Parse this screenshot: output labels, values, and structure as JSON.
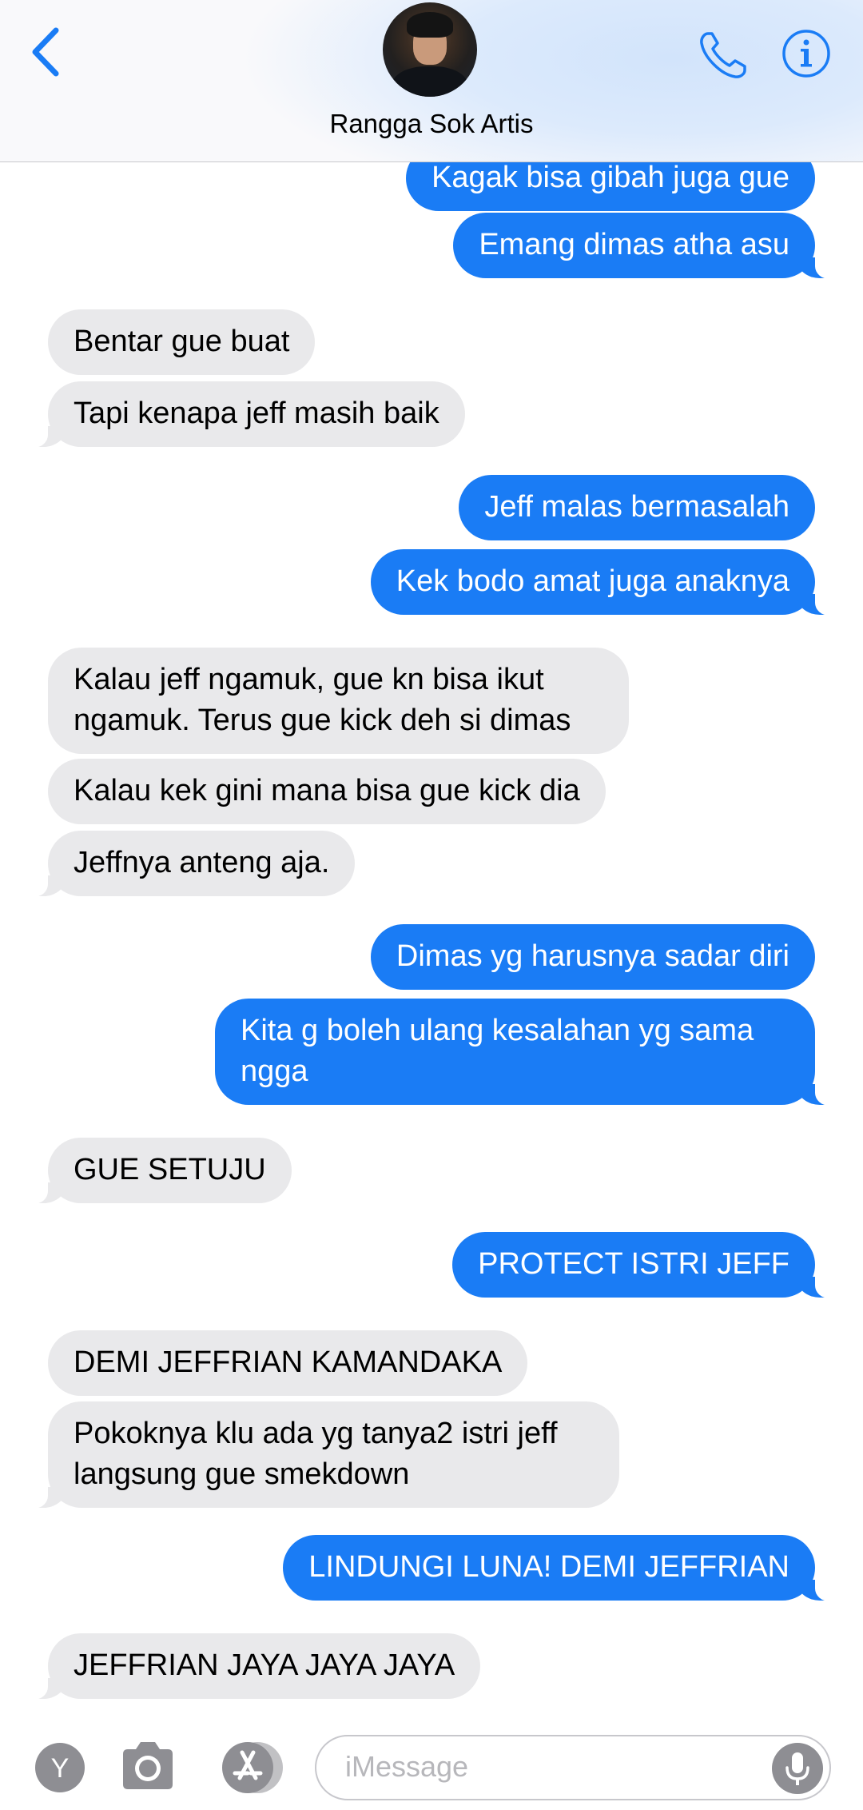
{
  "header": {
    "contact_name": "Rangga Sok Artis"
  },
  "messages": [
    {
      "side": "sent",
      "text": "Kagak bisa gibah juga gue",
      "tail": false
    },
    {
      "side": "sent",
      "text": "Emang dimas atha asu",
      "tail": true
    },
    {
      "side": "recv",
      "text": "Bentar gue buat",
      "tail": false
    },
    {
      "side": "recv",
      "text": "Tapi kenapa jeff masih baik",
      "tail": true
    },
    {
      "side": "sent",
      "text": "Jeff malas bermasalah",
      "tail": false
    },
    {
      "side": "sent",
      "text": "Kek bodo amat juga anaknya",
      "tail": true
    },
    {
      "side": "recv",
      "text": "Kalau jeff ngamuk, gue kn bisa ikut ngamuk. Terus gue kick deh si dimas",
      "tail": false
    },
    {
      "side": "recv",
      "text": "Kalau kek gini mana bisa gue kick dia",
      "tail": false
    },
    {
      "side": "recv",
      "text": "Jeffnya anteng aja.",
      "tail": true
    },
    {
      "side": "sent",
      "text": "Dimas yg harusnya sadar diri",
      "tail": false
    },
    {
      "side": "sent",
      "text": "Kita g boleh ulang kesalahan yg sama ngga",
      "tail": true
    },
    {
      "side": "recv",
      "text": "GUE SETUJU",
      "tail": true
    },
    {
      "side": "sent",
      "text": "PROTECT ISTRI JEFF",
      "tail": true
    },
    {
      "side": "recv",
      "text": "DEMI JEFFRIAN KAMANDAKA",
      "tail": false
    },
    {
      "side": "recv",
      "text": "Pokoknya klu ada yg tanya2 istri jeff langsung gue smekdown",
      "tail": true
    },
    {
      "side": "sent",
      "text": "LINDUNGI LUNA! DEMI JEFFRIAN",
      "tail": true
    },
    {
      "side": "recv",
      "text": "JEFFRIAN JAYA JAYA JAYA",
      "tail": true
    }
  ],
  "composer": {
    "placeholder": "iMessage",
    "avatar_letter": "Y"
  },
  "colors": {
    "accent": "#1a7cf5",
    "received_bubble": "#e9e9eb",
    "icon_gray": "#8e8e93"
  },
  "icons": [
    "back-chevron-icon",
    "phone-icon",
    "info-icon",
    "camera-icon",
    "app-store-icon",
    "microphone-icon"
  ]
}
